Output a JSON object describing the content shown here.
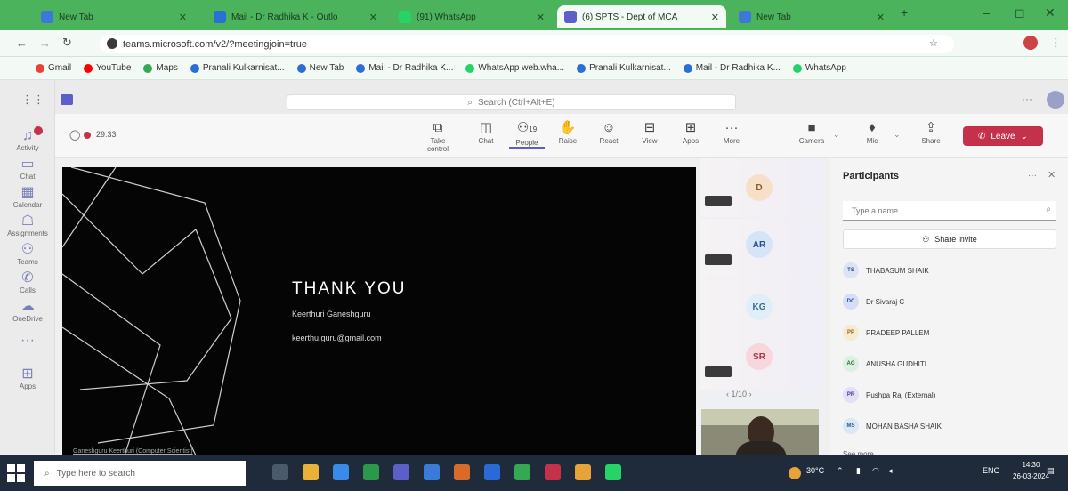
{
  "browser": {
    "tabs": [
      {
        "title": "New Tab",
        "fav": "#3c78d8"
      },
      {
        "title": "Mail - Dr Radhika K - Outlo",
        "fav": "#2a6fd6"
      },
      {
        "title": "(91) WhatsApp",
        "fav": "#25d366"
      },
      {
        "title": "(6) SPTS - Dept of MCA",
        "fav": "#5b5fc7"
      },
      {
        "title": "New Tab",
        "fav": "#3c78d8"
      }
    ],
    "url": "teams.microsoft.com/v2/?meetingjoin=true",
    "bookmarks": [
      {
        "label": "Gmail",
        "color": "#ea4335"
      },
      {
        "label": "YouTube",
        "color": "#ff0000"
      },
      {
        "label": "Maps",
        "color": "#34a853"
      },
      {
        "label": "Pranali Kulkarnisat...",
        "color": "#2a6fd6"
      },
      {
        "label": "New Tab",
        "color": "#2a6fd6"
      },
      {
        "label": "Mail - Dr Radhika K...",
        "color": "#2a6fd6"
      },
      {
        "label": "WhatsApp web.wha...",
        "color": "#25d366"
      },
      {
        "label": "Pranali Kulkarnisat...",
        "color": "#2a6fd6"
      },
      {
        "label": "Mail - Dr Radhika K...",
        "color": "#2a6fd6"
      },
      {
        "label": "WhatsApp",
        "color": "#25d366"
      }
    ]
  },
  "rail": [
    {
      "label": "Activity",
      "icon": "bell-icon"
    },
    {
      "label": "Chat",
      "icon": "chat-icon"
    },
    {
      "label": "Calendar",
      "icon": "calendar-icon"
    },
    {
      "label": "Assignments",
      "icon": "assignments-icon"
    },
    {
      "label": "Teams",
      "icon": "teams-icon"
    },
    {
      "label": "Calls",
      "icon": "phone-icon"
    },
    {
      "label": "OneDrive",
      "icon": "cloud-icon"
    },
    {
      "label": "Apps",
      "icon": "apps-icon"
    }
  ],
  "search": {
    "placeholder": "Search (Ctrl+Alt+E)"
  },
  "meeting": {
    "timer": "29:33",
    "participant_count": "19",
    "tools": [
      "Take control",
      "Chat",
      "People",
      "Raise",
      "React",
      "View",
      "Apps",
      "More",
      "Camera",
      "Mic",
      "Share"
    ],
    "leave_label": "Leave"
  },
  "slide": {
    "title": "THANK YOU",
    "name": "Keerthuri Ganeshguru",
    "email": "keerthu.guru@gmail.com",
    "footer": "Ganeshguru Keerthuri (Computer Scientist)"
  },
  "tiles": [
    {
      "initials": "D",
      "bg": "#f7e0c8",
      "fg": "#8a5a2a"
    },
    {
      "initials": "AR",
      "bg": "#d6e4f7",
      "fg": "#2a4e8a"
    },
    {
      "initials": "KG",
      "bg": "#e0eef7",
      "fg": "#3a6a8a"
    },
    {
      "initials": "SR",
      "bg": "#f7d6dc",
      "fg": "#a3354a"
    }
  ],
  "pager": "1/10",
  "participants": {
    "title": "Participants",
    "search_placeholder": "Type a name",
    "share_invite": "Share invite",
    "people": [
      {
        "initials": "TS",
        "name": "THABASUM SHAIK",
        "bg": "#dbe3f5",
        "fg": "#3a4e8a"
      },
      {
        "initials": "DC",
        "name": "Dr Sivaraj C",
        "bg": "#d6def7",
        "fg": "#2e47a0"
      },
      {
        "initials": "PP",
        "name": "PRADEEP PALLEM",
        "bg": "#f7ead0",
        "fg": "#8a6a1a"
      },
      {
        "initials": "AG",
        "name": "ANUSHA GUDHITI",
        "bg": "#dcefe0",
        "fg": "#2a6a3a"
      },
      {
        "initials": "PR",
        "name": "Pushpa Raj (External)",
        "bg": "#e2e0f7",
        "fg": "#4a3a8a"
      },
      {
        "initials": "MS",
        "name": "MOHAN BASHA SHAIK",
        "bg": "#dbe7f5",
        "fg": "#2a5a8a"
      }
    ],
    "see_more": "See more"
  },
  "taskbar": {
    "search": "Type here to search",
    "weather": "30°C",
    "lang": "ENG",
    "time": "14:30",
    "date": "26-03-2024"
  }
}
